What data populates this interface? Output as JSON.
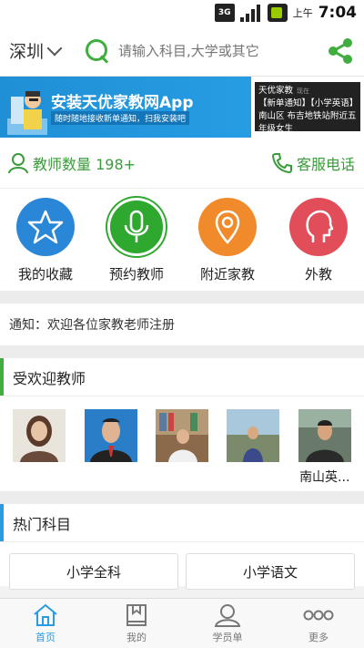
{
  "status_bar": {
    "ampm": "上午",
    "time": "7:04",
    "net": "3G"
  },
  "header": {
    "city": "深圳",
    "search_placeholder": "请输入科目,大学或其它"
  },
  "banner": {
    "title": "安装天优家教网App",
    "subtitle": "随时随地接收新单通知，扫我安装吧",
    "notify_title": "天优家教",
    "notify_time": "现在",
    "notify_body": "【新单通知】【小学英语】南山区 布吉地铁站附近五年级女生"
  },
  "stats": {
    "teacher_count_label": "教师数量 198+",
    "hotline_label": "客服电话"
  },
  "quick_actions": [
    {
      "label": "我的收藏",
      "color": "#2a86d6",
      "icon": "star-icon"
    },
    {
      "label": "预约教师",
      "color": "#2ea82e",
      "icon": "microphone-icon"
    },
    {
      "label": "附近家教",
      "color": "#f08a2a",
      "icon": "location-pin-icon"
    },
    {
      "label": "外教",
      "color": "#e24d5a",
      "icon": "head-icon"
    }
  ],
  "notice": "通知：欢迎各位家教老师注册",
  "popular_teachers": {
    "title": "受欢迎教师",
    "items": [
      {
        "name": ""
      },
      {
        "name": ""
      },
      {
        "name": ""
      },
      {
        "name": ""
      },
      {
        "name": "南山英..."
      }
    ]
  },
  "hot_subjects": {
    "title": "热门科目",
    "items": [
      "小学全科",
      "小学语文"
    ]
  },
  "bottom_nav": [
    {
      "label": "首页",
      "icon": "home-icon",
      "active": true
    },
    {
      "label": "我的",
      "icon": "book-icon",
      "active": false
    },
    {
      "label": "学员单",
      "icon": "user-icon",
      "active": false
    },
    {
      "label": "更多",
      "icon": "more-icon",
      "active": false
    }
  ],
  "colors": {
    "accent_green": "#3fae3f",
    "accent_blue": "#2a9be0"
  }
}
